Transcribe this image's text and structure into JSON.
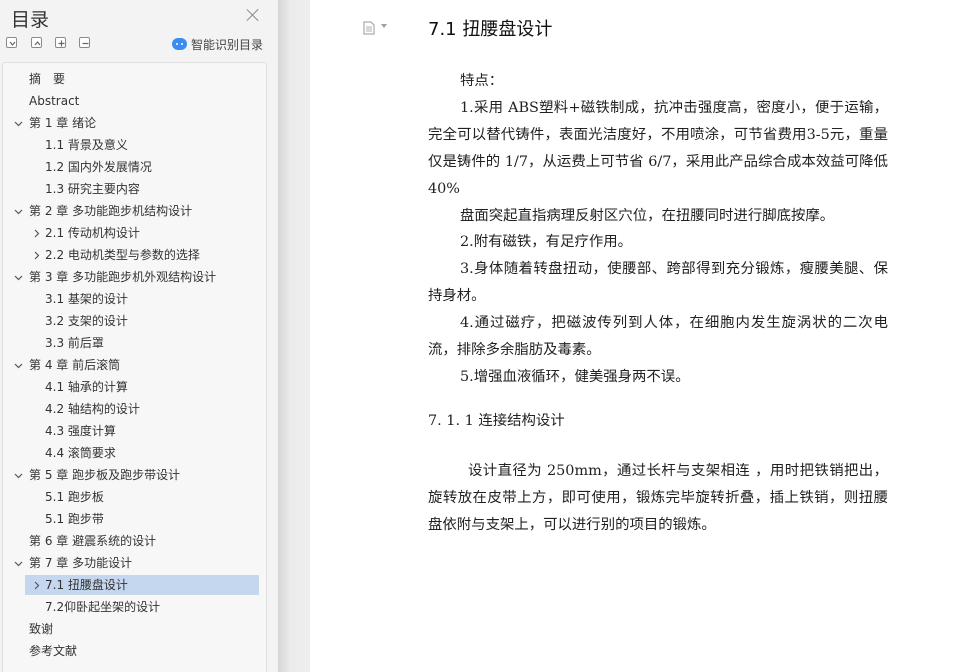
{
  "toc": {
    "title": "目录",
    "smart_label": "智能识别目录",
    "items": [
      {
        "label": "摘　要",
        "level": 0,
        "expander": "none"
      },
      {
        "label": "Abstract",
        "level": 0,
        "expander": "none"
      },
      {
        "label": "第 1 章 绪论",
        "level": 0,
        "expander": "down"
      },
      {
        "label": "1.1 背景及意义",
        "level": 1,
        "expander": "none"
      },
      {
        "label": "1.2 国内外发展情况",
        "level": 1,
        "expander": "none"
      },
      {
        "label": "1.3 研究主要内容",
        "level": 1,
        "expander": "none"
      },
      {
        "label": "第 2 章 多功能跑步机结构设计",
        "level": 0,
        "expander": "down"
      },
      {
        "label": "2.1 传动机构设计",
        "level": 1,
        "expander": "right"
      },
      {
        "label": "2.2 电动机类型与参数的选择",
        "level": 1,
        "expander": "right"
      },
      {
        "label": "第 3 章 多功能跑步机外观结构设计",
        "level": 0,
        "expander": "down"
      },
      {
        "label": "3.1 基架的设计",
        "level": 1,
        "expander": "none"
      },
      {
        "label": "3.2 支架的设计",
        "level": 1,
        "expander": "none"
      },
      {
        "label": "3.3 前后罩",
        "level": 1,
        "expander": "none"
      },
      {
        "label": "第 4 章 前后滚筒",
        "level": 0,
        "expander": "down"
      },
      {
        "label": "4.1 轴承的计算",
        "level": 1,
        "expander": "none"
      },
      {
        "label": "4.2 轴结构的设计",
        "level": 1,
        "expander": "none"
      },
      {
        "label": "4.3 强度计算",
        "level": 1,
        "expander": "none"
      },
      {
        "label": "4.4 滚筒要求",
        "level": 1,
        "expander": "none"
      },
      {
        "label": "第 5 章 跑步板及跑步带设计",
        "level": 0,
        "expander": "down"
      },
      {
        "label": "5.1 跑步板",
        "level": 1,
        "expander": "none"
      },
      {
        "label": "5.1 跑步带",
        "level": 1,
        "expander": "none"
      },
      {
        "label": "第 6 章 避震系统的设计",
        "level": 0,
        "expander": "none"
      },
      {
        "label": "第 7 章 多功能设计",
        "level": 0,
        "expander": "down"
      },
      {
        "label": "7.1 扭腰盘设计",
        "level": 1,
        "expander": "right",
        "selected": true
      },
      {
        "label": "7.2仰卧起坐架的设计",
        "level": 1,
        "expander": "none"
      },
      {
        "label": "致谢",
        "level": 0,
        "expander": "none"
      },
      {
        "label": "参考文献",
        "level": 0,
        "expander": "none"
      }
    ]
  },
  "doc": {
    "heading": "7.1 扭腰盘设计",
    "p1": "特点：",
    "p2": "1.采用 ABS塑料+磁铁制成，抗冲击强度高，密度小，便于运输，完全可以替代铸件，表面光洁度好，不用喷涂，可节省费用3-5元，重量仅是铸件的 1/7，从运费上可节省 6/7，采用此产品综合成本效益可降低 40%",
    "p3": "盘面突起直指病理反射区穴位，在扭腰同时进行脚底按摩。",
    "p4": "2.附有磁铁，有足疗作用。",
    "p5": "3.身体随着转盘扭动，使腰部、跨部得到充分锻炼，瘦腰美腿、保持身材。",
    "p6": "4.通过磁疗，把磁波传列到人体，在细胞内发生旋涡状的二次电流，排除多余脂肪及毒素。",
    "p7": "5.增强血液循环，健美强身两不误。",
    "subheading": "7. 1. 1 连接结构设计",
    "p8": "设计直径为 250mm，通过长杆与支架相连 ，用时把铁销把出，旋转放在皮带上方，即可使用，锻炼完毕旋转折叠，插上铁销，则扭腰盘依附与支架上，可以进行别的项目的锻炼。"
  }
}
